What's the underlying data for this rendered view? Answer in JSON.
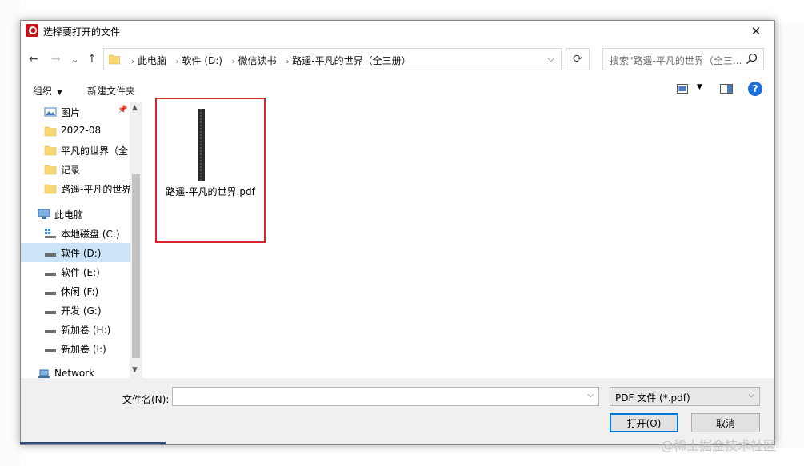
{
  "dialog": {
    "title": "选择要打开的文件",
    "close_glyph": "✕"
  },
  "nav": {
    "back": "←",
    "forward": "→",
    "recent": "⌄",
    "up": "↑",
    "breadcrumb": [
      "此电脑",
      "软件 (D:)",
      "微信读书",
      "路遥-平凡的世界（全三册）"
    ],
    "separator": "›",
    "refresh": "⟳",
    "search_placeholder": "搜索\"路遥-平凡的世界（全三..."
  },
  "toolbar": {
    "organize": "组织",
    "new_folder": "新建文件夹",
    "help": "?"
  },
  "sidebar": {
    "items": [
      {
        "label": "图片",
        "icon": "pictures-icon"
      },
      {
        "label": "2022-08",
        "icon": "folder-icon"
      },
      {
        "label": "平凡的世界（全",
        "icon": "folder-icon"
      },
      {
        "label": "记录",
        "icon": "folder-icon"
      },
      {
        "label": "路遥-平凡的世界",
        "icon": "folder-icon"
      },
      {
        "label": "此电脑",
        "icon": "computer-icon"
      },
      {
        "label": "本地磁盘 (C:)",
        "icon": "drive-os-icon"
      },
      {
        "label": "软件 (D:)",
        "icon": "drive-icon"
      },
      {
        "label": "软件 (E:)",
        "icon": "drive-icon"
      },
      {
        "label": "休闲 (F:)",
        "icon": "drive-icon"
      },
      {
        "label": "开发 (G:)",
        "icon": "drive-icon"
      },
      {
        "label": "新加卷 (H:)",
        "icon": "drive-icon"
      },
      {
        "label": "新加卷 (I:)",
        "icon": "drive-icon"
      },
      {
        "label": "Network",
        "icon": "network-icon"
      }
    ],
    "selected": "软件 (D:)"
  },
  "files": [
    {
      "name": "路遥-平凡的世界.pdf"
    }
  ],
  "footer": {
    "filename_label": "文件名(N):",
    "filename_value": "",
    "filetype": "PDF 文件 (*.pdf)",
    "open_label": "打开(O)",
    "cancel_label": "取消"
  },
  "watermark": "@稀土掘金技术社区",
  "colors": {
    "selection": "#cce4f7",
    "highlight_border": "#d9252a",
    "accent": "#0078d7",
    "folder": "#f8d775"
  }
}
